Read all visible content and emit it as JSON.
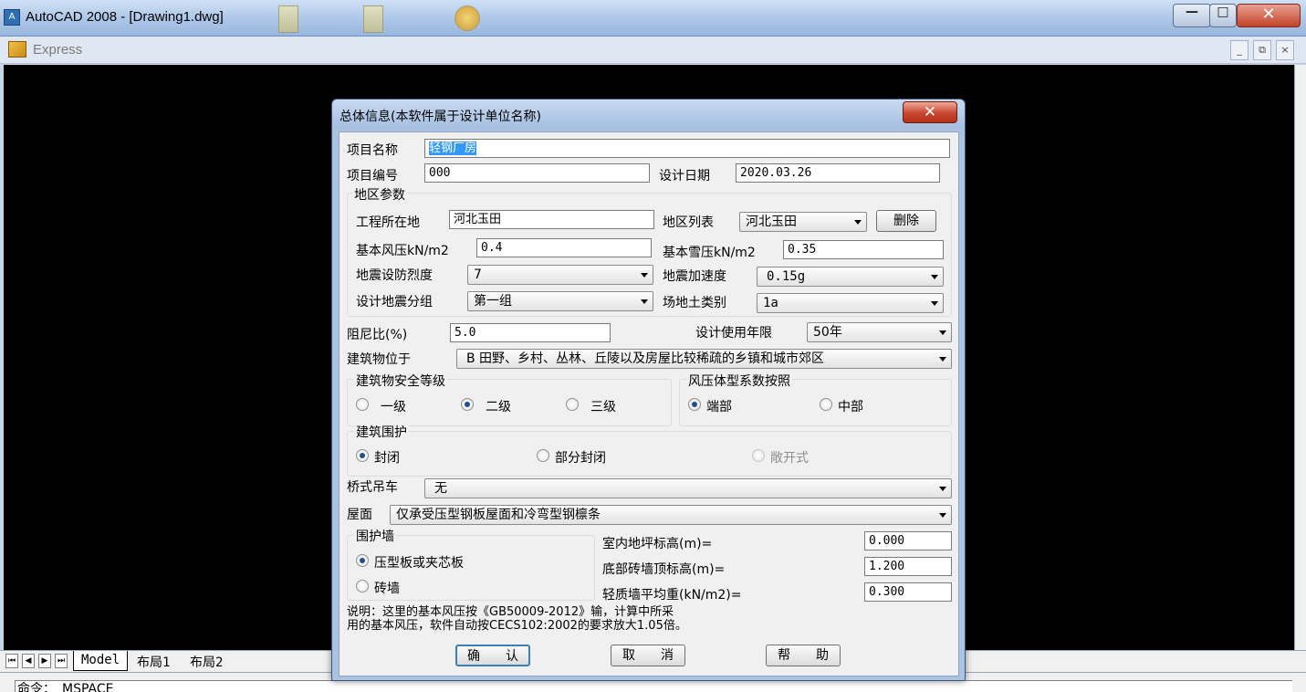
{
  "app": {
    "title": "AutoCAD 2008 - [Drawing1.dwg]",
    "icon": "A",
    "menu_label": "Express",
    "buttons": {
      "minimize": "—",
      "maximize": "□",
      "close": "✕"
    },
    "mdi_buttons": {
      "minimize": "_",
      "restore": "⧉",
      "close": "×"
    }
  },
  "tabs": {
    "items": [
      "Model",
      "布局1",
      "布局2"
    ],
    "nav": [
      "⏮",
      "◀",
      "▶",
      "⏭"
    ]
  },
  "command_line": {
    "text": "命令：_MSPACE"
  },
  "dialog": {
    "title": "总体信息(本软件属于设计单位名称)",
    "close_glyph": "✕",
    "project_name_label": "项目名称",
    "project_name_value": "轻钢厂房",
    "project_code_label": "项目编号",
    "project_code_value": "000",
    "design_date_label": "设计日期",
    "design_date_value": "2020.03.26",
    "region_group": {
      "title": "地区参数",
      "location_label": "工程所在地",
      "location_value": "河北玉田",
      "region_list_label": "地区列表",
      "region_list_value": "河北玉田",
      "delete_button": "删除",
      "wind_label": "基本风压kN/m2",
      "wind_value": "0.4",
      "snow_label": "基本雪压kN/m2",
      "snow_value": "0.35",
      "intensity_label": "地震设防烈度",
      "intensity_value": "7",
      "accel_label": "地震加速度",
      "accel_value": "0.15g",
      "group_label": "设计地震分组",
      "group_value": "第一组",
      "site_label": "场地土类别",
      "site_value": "1a"
    },
    "damping_label": "阻尼比(%)",
    "damping_value": "5.0",
    "service_life_label": "设计使用年限",
    "service_life_value": "50年",
    "location_type_label": "建筑物位于",
    "location_type_value": "B 田野、乡村、丛林、丘陵以及房屋比较稀疏的乡镇和城市郊区",
    "safety_group": {
      "title": "建筑物安全等级",
      "options": [
        "一级",
        "二级",
        "三级"
      ],
      "selected": 1
    },
    "wind_coef_group": {
      "title": "风压体型系数按照",
      "options": [
        "端部",
        "中部"
      ],
      "selected": 0
    },
    "enclosure_group": {
      "title": "建筑围护",
      "options": [
        "封闭",
        "部分封闭",
        "敞开式"
      ],
      "selected": 0,
      "disabled": 2
    },
    "crane_label": "桥式吊车",
    "crane_value": "无",
    "roof_label": "屋面",
    "roof_value": "仅承受压型钢板屋面和冷弯型钢檩条",
    "wall_group": {
      "title": "围护墙",
      "options": [
        "压型板或夹芯板",
        "砖墙"
      ],
      "selected": 0
    },
    "floor_elev_label": "室内地坪标高(m)=",
    "floor_elev_value": "0.000",
    "brick_top_label": "底部砖墙顶标高(m)=",
    "brick_top_value": "1.200",
    "light_wall_label": "轻质墙平均重(kN/m2)=",
    "light_wall_value": "0.300",
    "note": "说明：这里的基本风压按《GB50009-2012》输，计算中所采\n用的基本风压，软件自动按CECS102:2002的要求放大1.05倍。",
    "ok_button": "确　　认",
    "cancel_button": "取　　消",
    "help_button": "帮　　助"
  }
}
